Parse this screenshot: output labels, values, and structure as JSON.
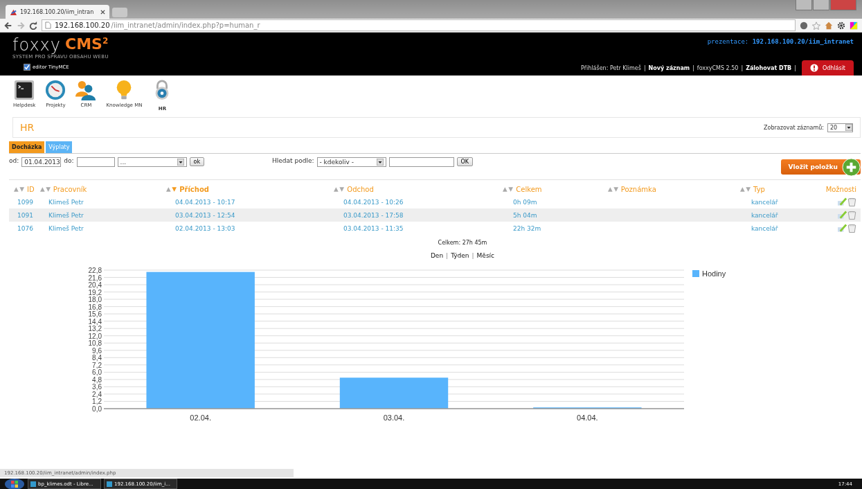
{
  "browser": {
    "tab_title": "192.168.100.20/iim_intran",
    "url_host": "192.168.100.20",
    "url_path": "/iim_intranet/admin/index.php?p=human_r",
    "status_url": "192.168.100.20/iim_intranet/admin/index.php"
  },
  "header": {
    "logo_main": "foxxy",
    "logo_brand": "CMS",
    "logo_sup": "2",
    "tagline": "SYSTEM PRO SPRAVU OBSAHU WEBU",
    "editor": {
      "label": "editor TinyMCE",
      "checked": true
    },
    "presentation_label": "prezentace:",
    "presentation_url": "192.168.100.20/iim_intranet",
    "user": "Přihlášen: Petr Klimeš",
    "links": [
      {
        "kind": "separator",
        "label": "|"
      },
      {
        "kind": "link",
        "label": "Nový záznam",
        "bold": true
      },
      {
        "kind": "separator",
        "label": "|"
      },
      {
        "kind": "link",
        "label": "foxxyCMS 2.50",
        "bold": false
      },
      {
        "kind": "separator",
        "label": "|"
      },
      {
        "kind": "link",
        "label": "Zálohovat DTB",
        "bold": true
      },
      {
        "kind": "separator",
        "label": "|"
      }
    ],
    "logout": "Odhlásit"
  },
  "modules": [
    {
      "label": "Helpdesk",
      "kind": "terminal",
      "selected": false
    },
    {
      "label": "Projekty",
      "kind": "clock",
      "selected": false
    },
    {
      "label": "CRM",
      "kind": "people",
      "selected": false
    },
    {
      "label": "Knowledge MN",
      "kind": "bulb",
      "selected": false
    },
    {
      "label": "HR",
      "kind": "lock",
      "selected": true
    }
  ],
  "section": {
    "title": "HR",
    "records_label": "Zobrazovat záznamů:",
    "records_value": "20"
  },
  "tabs": [
    {
      "label": "Docházka",
      "selected": true
    },
    {
      "label": "Výplaty",
      "selected": false
    }
  ],
  "filter": {
    "from_label": "od:",
    "from_value": "01.04.2013",
    "to_label": "do:",
    "period_select": "...",
    "ok": "ok",
    "search_label": "Hledat podle:",
    "search_select": "- kdekoliv -",
    "search_ok": "OK"
  },
  "add_button": "Vložit položku",
  "table": {
    "columns": [
      {
        "label": "ID",
        "sortable": true,
        "sorted": false
      },
      {
        "label": "Pracovník",
        "sortable": true,
        "sorted": false
      },
      {
        "label": "Příchod",
        "sortable": true,
        "sorted": true
      },
      {
        "label": "Odchod",
        "sortable": true,
        "sorted": false
      },
      {
        "label": "Celkem",
        "sortable": true,
        "sorted": false
      },
      {
        "label": "Poznámka",
        "sortable": true,
        "sorted": false
      },
      {
        "label": "Typ",
        "sortable": true,
        "sorted": false
      },
      {
        "label": "Možnosti",
        "sortable": false,
        "sorted": false
      }
    ],
    "rows": [
      {
        "id": "1099",
        "worker": "Klimeš Petr",
        "arrival": "04.04.2013 - 10:17",
        "departure": "04.04.2013 - 10:26",
        "total": "0h 09m",
        "type": "kancelář"
      },
      {
        "id": "1091",
        "worker": "Klimeš Petr",
        "arrival": "03.04.2013 - 12:54",
        "departure": "03.04.2013 - 17:58",
        "total": "5h 04m",
        "type": "kancelář"
      },
      {
        "id": "1076",
        "worker": "Klimeš Petr",
        "arrival": "02.04.2013 - 13:03",
        "departure": "03.04.2013 - 11:35",
        "total": "22h 32m",
        "type": "kancelář"
      }
    ]
  },
  "summary": "Celkem: 27h 45m",
  "views": [
    {
      "kind": "link",
      "label": "Den"
    },
    {
      "kind": "separator",
      "label": "|"
    },
    {
      "kind": "link",
      "label": "Týden"
    },
    {
      "kind": "separator",
      "label": "|"
    },
    {
      "kind": "link",
      "label": "Měsíc"
    }
  ],
  "chart_data": {
    "type": "bar",
    "categories": [
      "02.04.",
      "03.04.",
      "04.04."
    ],
    "series": [
      {
        "name": "Hodiny",
        "color": "#58b4fc",
        "values": [
          22.5,
          5.1,
          0.2
        ]
      }
    ],
    "grid": true,
    "ylim": [
      0,
      22.8
    ],
    "yticks": [
      {
        "value": 0,
        "label": "0,0"
      },
      {
        "value": 1.2,
        "label": "1,2"
      },
      {
        "value": 2.4,
        "label": "2,4"
      },
      {
        "value": 3.6,
        "label": "3,6"
      },
      {
        "value": 4.8,
        "label": "4,8"
      },
      {
        "value": 6,
        "label": "6,0"
      },
      {
        "value": 7.2,
        "label": "7,2"
      },
      {
        "value": 8.4,
        "label": "8,4"
      },
      {
        "value": 9.6,
        "label": "9,6"
      },
      {
        "value": 10.8,
        "label": "10,8"
      },
      {
        "value": 12,
        "label": "12,0"
      },
      {
        "value": 13.2,
        "label": "13,2"
      },
      {
        "value": 14.4,
        "label": "14,4"
      },
      {
        "value": 15.6,
        "label": "15,6"
      },
      {
        "value": 16.8,
        "label": "16,8"
      },
      {
        "value": 18,
        "label": "18,0"
      },
      {
        "value": 19.2,
        "label": "19,2"
      },
      {
        "value": 20.4,
        "label": "20,4"
      },
      {
        "value": 21.6,
        "label": "21,6"
      },
      {
        "value": 22.8,
        "label": "22,8"
      }
    ]
  },
  "taskbar": {
    "items": [
      "bp_klimes.odt - Libre...",
      "192.168.100.20/iim_i..."
    ],
    "clock": "17:44"
  }
}
